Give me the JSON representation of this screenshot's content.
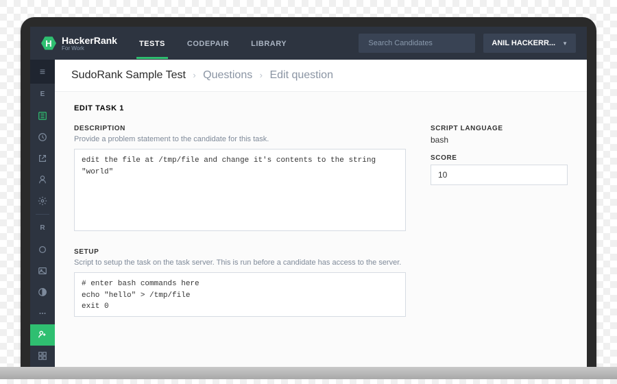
{
  "brand": {
    "name": "HackerRank",
    "subtitle": "For Work",
    "initial": "H"
  },
  "nav": {
    "tabs": [
      {
        "label": "TESTS",
        "active": true
      },
      {
        "label": "CODEPAIR",
        "active": false
      },
      {
        "label": "LIBRARY",
        "active": false
      }
    ],
    "search_placeholder": "Search Candidates",
    "user_label": "ANIL HACKERR..."
  },
  "breadcrumb": {
    "root": "SudoRank Sample Test",
    "mid": "Questions",
    "leaf": "Edit question"
  },
  "sidebar": {
    "items": [
      "E",
      "list",
      "clock",
      "external",
      "user",
      "gear"
    ],
    "section2": [
      "R",
      "circle",
      "image",
      "contrast",
      "dots"
    ]
  },
  "form": {
    "edit_title": "EDIT TASK 1",
    "description_label": "DESCRIPTION",
    "description_helper": "Provide a problem statement to the candidate for this task.",
    "description_value": "edit the file at /tmp/file and change it's contents to the string \"world\"",
    "setup_label": "SETUP",
    "setup_helper": "Script to setup the task on the task server. This is run before a candidate has access to the server.",
    "setup_value": "# enter bash commands here\necho \"hello\" > /tmp/file\nexit 0",
    "lang_label": "SCRIPT LANGUAGE",
    "lang_value": "bash",
    "score_label": "SCORE",
    "score_value": "10"
  }
}
